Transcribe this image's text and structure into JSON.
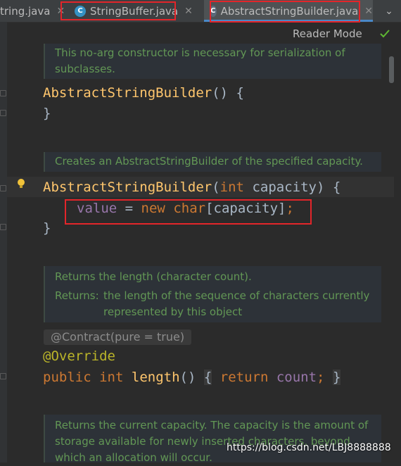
{
  "tabs": [
    {
      "label": "tring.java"
    },
    {
      "label": "StringBuffer.java"
    },
    {
      "label": "AbstractStringBuilder.java"
    }
  ],
  "editor": {
    "reader_mode": "Reader Mode",
    "doc1": [
      "This no-arg constructor is necessary for serialization of",
      "subclasses."
    ],
    "code1_name": "AbstractStringBuilder",
    "code1_rest": "() {",
    "brace": "}",
    "doc2": "Creates an AbstractStringBuilder of the specified capacity.",
    "ctor_name": "AbstractStringBuilder",
    "ctor_type": "int",
    "ctor_param": "capacity",
    "field_value": "value",
    "new_kw": "new",
    "char_kw": "char",
    "capacity_arg": "capacity",
    "doc3": {
      "line1": "Returns the length (character count).",
      "returns_label": "Returns:",
      "returns_text1": "the length of the sequence of characters currently",
      "returns_text2": "represented by this object"
    },
    "contract": "@Contract(pure = true)",
    "override": "@Override",
    "public_kw": "public",
    "int_kw": "int",
    "length_fn": "length",
    "return_kw": "return",
    "count_field": "count",
    "doc4": [
      "Returns the current capacity. The capacity is the amount of",
      "storage available for newly inserted characters, beyond",
      "which an allocation will occur."
    ],
    "watermark": "https://blog.csdn.net/LBJ8888888"
  },
  "colors": {
    "keyword": "#cc7832",
    "method": "#ffc66d",
    "field": "#9876aa",
    "doc": "#629755",
    "annotation": "#bbb529",
    "highlight": "#e3252a"
  }
}
